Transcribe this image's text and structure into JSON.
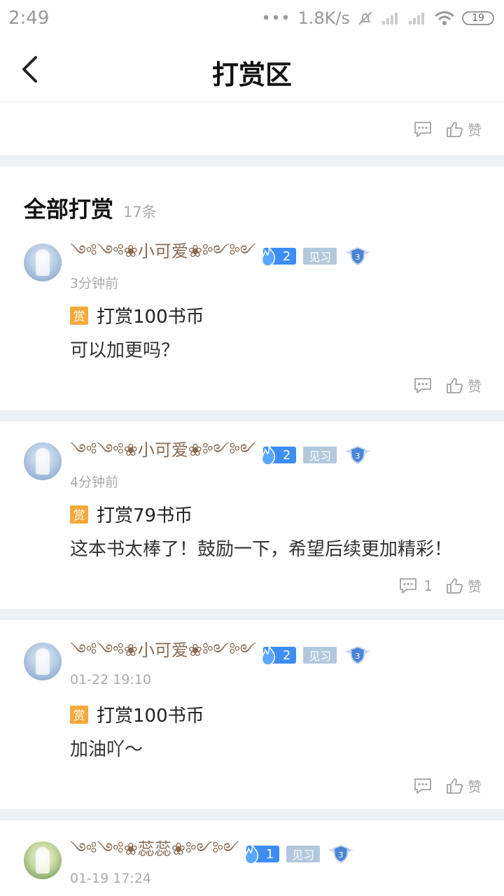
{
  "status_bar": {
    "time": "2:49",
    "dots": "•••",
    "net_speed": "1.8K/s",
    "battery": "19"
  },
  "header": {
    "title": "打赏区"
  },
  "top_actions": {
    "like_label": "赞"
  },
  "section": {
    "title": "全部打赏",
    "count": "17条"
  },
  "items": [
    {
      "username": "༺༺❀小可爱❀༻༻",
      "level": "2",
      "tag": "见习",
      "shield_level": "3",
      "time": "3分钟前",
      "reward_badge": "赏",
      "reward": "打赏100书币",
      "comment": "可以加更吗？",
      "comment_count": "",
      "like_label": "赞"
    },
    {
      "username": "༺༺❀小可爱❀༻༻",
      "level": "2",
      "tag": "见习",
      "shield_level": "3",
      "time": "4分钟前",
      "reward_badge": "赏",
      "reward": "打赏79书币",
      "comment": "这本书太棒了！鼓励一下，希望后续更加精彩！",
      "comment_count": "1",
      "like_label": "赞"
    },
    {
      "username": "༺༺❀小可爱❀༻༻",
      "level": "2",
      "tag": "见习",
      "shield_level": "3",
      "time": "01-22 19:10",
      "reward_badge": "赏",
      "reward": "打赏100书币",
      "comment": "加油吖～",
      "comment_count": "",
      "like_label": "赞"
    },
    {
      "username": "༺༺❀蕊蕊❀༻༻",
      "level": "1",
      "tag": "见习",
      "shield_level": "3",
      "time": "01-19 17:24"
    }
  ],
  "colors": {
    "accent_blue": "#3d8df5",
    "reward_orange": "#f5a93b",
    "divider": "#eef1f4",
    "username_brown": "#8a6a52"
  }
}
